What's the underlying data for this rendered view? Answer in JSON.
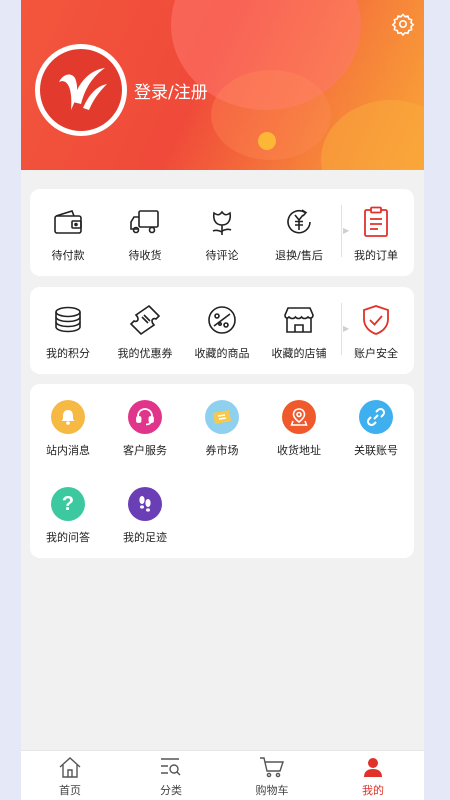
{
  "header": {
    "login_text": "登录/注册"
  },
  "orders": [
    {
      "label": "待付款",
      "icon": "wallet-icon"
    },
    {
      "label": "待收货",
      "icon": "truck-icon"
    },
    {
      "label": "待评论",
      "icon": "flower-icon"
    },
    {
      "label": "退换/售后",
      "icon": "yuan-refund-icon"
    },
    {
      "label": "我的订单",
      "icon": "clipboard-icon"
    }
  ],
  "assets": [
    {
      "label": "我的积分",
      "icon": "coins-icon"
    },
    {
      "label": "我的优惠券",
      "icon": "coupon-icon"
    },
    {
      "label": "收藏的商品",
      "icon": "palette-icon"
    },
    {
      "label": "收藏的店铺",
      "icon": "store-icon"
    },
    {
      "label": "账户安全",
      "icon": "shield-check-icon"
    }
  ],
  "services": [
    {
      "label": "站内消息",
      "icon": "bell-icon",
      "color": "#f5b944"
    },
    {
      "label": "客户服务",
      "icon": "headset-icon",
      "color": "#e0358a"
    },
    {
      "label": "券市场",
      "icon": "ticket-icon",
      "color": "#8fd0ef"
    },
    {
      "label": "收货地址",
      "icon": "map-pin-icon",
      "color": "#f0592c"
    },
    {
      "label": "关联账号",
      "icon": "link-icon",
      "color": "#3fb0ef"
    },
    {
      "label": "我的问答",
      "icon": "question-icon",
      "color": "#3dc9a0"
    },
    {
      "label": "我的足迹",
      "icon": "footprint-icon",
      "color": "#6a3fb6"
    }
  ],
  "tabbar": [
    {
      "label": "首页",
      "icon": "home-icon"
    },
    {
      "label": "分类",
      "icon": "category-search-icon"
    },
    {
      "label": "购物车",
      "icon": "cart-icon"
    },
    {
      "label": "我的",
      "icon": "user-icon",
      "active": true
    }
  ],
  "colors": {
    "accent": "#e0322a"
  }
}
